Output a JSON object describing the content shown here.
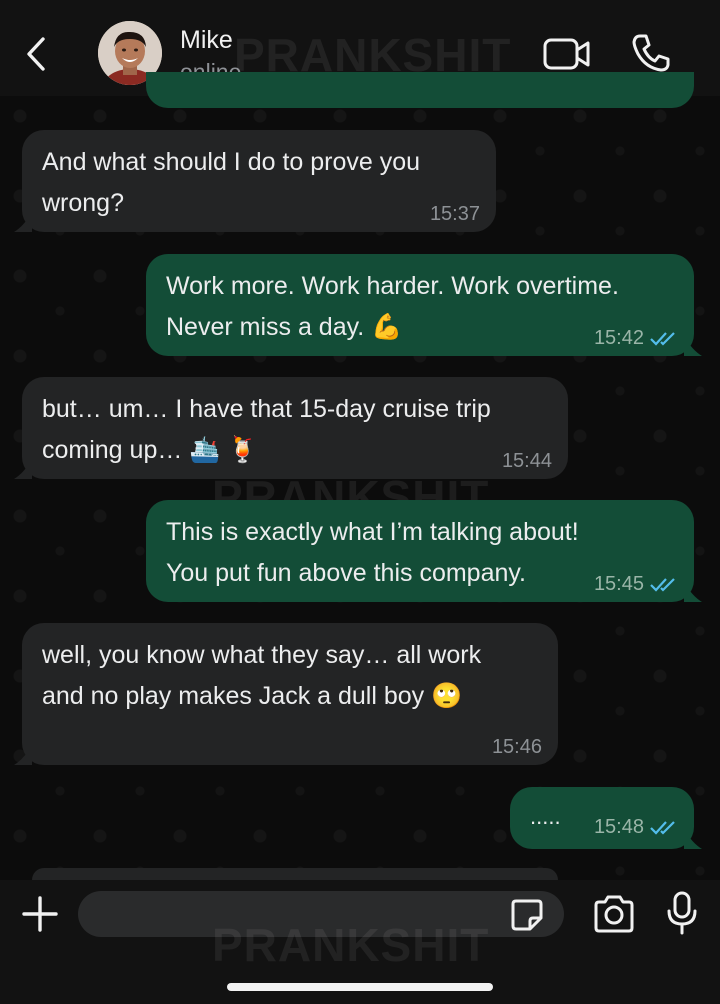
{
  "header": {
    "contact_name": "Mike",
    "status": "online",
    "icons": [
      "back-icon",
      "avatar",
      "video-call-icon",
      "phone-icon"
    ]
  },
  "watermark": "PRANKSHIT",
  "messages": [
    {
      "direction": "out",
      "text": "",
      "time": "",
      "partial": true
    },
    {
      "direction": "in",
      "lines": [
        "And what should I do to prove you",
        "wrong?"
      ],
      "time": "15:37"
    },
    {
      "direction": "out",
      "lines": [
        "Work more. Work harder. Work overtime.",
        "Never miss a day. 💪"
      ],
      "time": "15:42",
      "read": true
    },
    {
      "direction": "in",
      "lines": [
        "but… um… I have that 15-day cruise trip",
        "coming up… 🛳️ 🍹"
      ],
      "time": "15:44"
    },
    {
      "direction": "out",
      "lines": [
        "This is exactly what I’m talking about!",
        "You put fun above this company."
      ],
      "time": "15:45",
      "read": true
    },
    {
      "direction": "in",
      "lines": [
        "well, you know what they say… all work",
        "and no play makes Jack a dull boy 🙄"
      ],
      "time": "15:46"
    },
    {
      "direction": "out",
      "lines": [
        "....."
      ],
      "time": "15:48",
      "read": true
    }
  ],
  "composer": {
    "placeholder": "",
    "icons": [
      "plus-icon",
      "sticker-icon",
      "camera-icon",
      "mic-icon"
    ]
  },
  "colors": {
    "header_bg": "#121212",
    "incoming_bubble": "#232425",
    "outgoing_bubble": "#134d37",
    "read_ticks": "#53bdeb",
    "text": "#ecedee",
    "timestamp": "#8d9195"
  }
}
